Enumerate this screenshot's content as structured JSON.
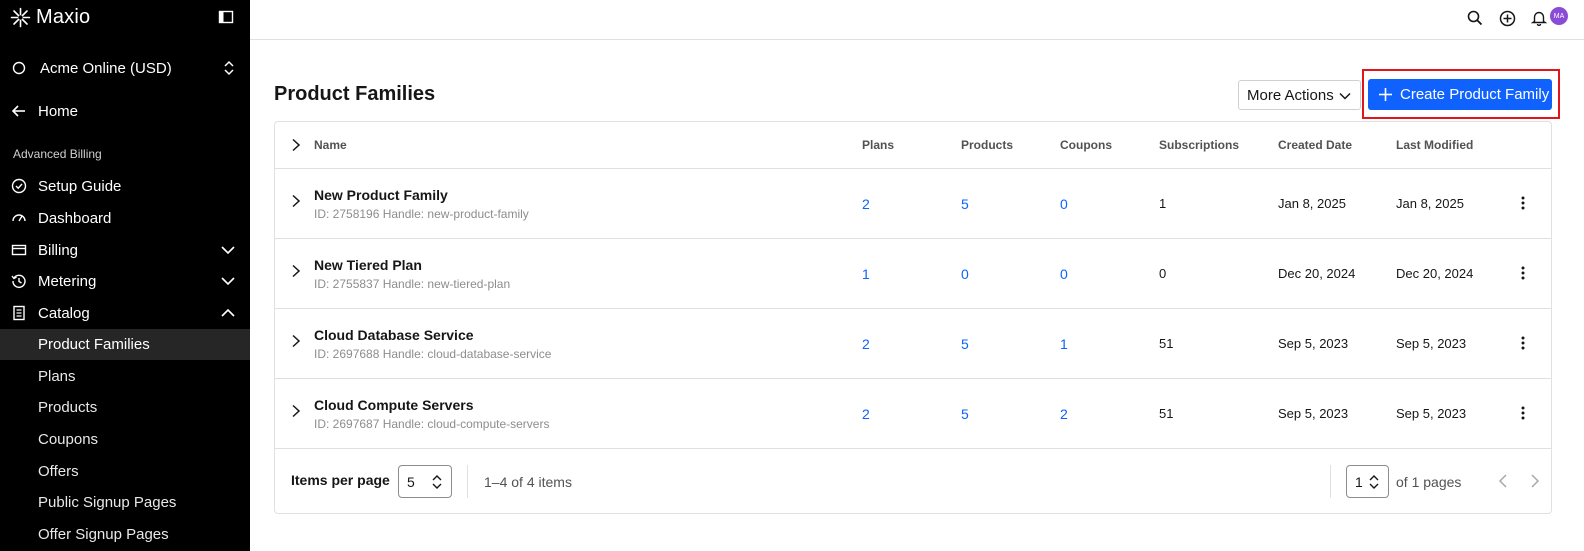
{
  "sidebar": {
    "logo": "Maxio",
    "account": "Acme Online (USD)",
    "home": "Home",
    "section": "Advanced Billing",
    "items": [
      {
        "label": "Setup Guide",
        "icon": "check-circle-icon"
      },
      {
        "label": "Dashboard",
        "icon": "gauge-icon"
      },
      {
        "label": "Billing",
        "icon": "card-icon"
      },
      {
        "label": "Metering",
        "icon": "history-icon"
      },
      {
        "label": "Catalog",
        "icon": "document-icon"
      }
    ],
    "catalog_items": [
      "Product Families",
      "Plans",
      "Products",
      "Coupons",
      "Offers",
      "Public Signup Pages",
      "Offer Signup Pages"
    ]
  },
  "topbar": {
    "avatar": "MA"
  },
  "page": {
    "title": "Product Families",
    "more_actions": "More Actions",
    "create": "Create Product Family"
  },
  "table": {
    "headers": [
      "Name",
      "Plans",
      "Products",
      "Coupons",
      "Subscriptions",
      "Created Date",
      "Last Modified"
    ],
    "rows": [
      {
        "name": "New Product Family",
        "meta": "ID: 2758196 Handle: new-product-family",
        "plans": "2",
        "products": "5",
        "coupons": "0",
        "subscriptions": "1",
        "created": "Jan 8, 2025",
        "modified": "Jan 8, 2025"
      },
      {
        "name": "New Tiered Plan",
        "meta": "ID: 2755837 Handle: new-tiered-plan",
        "plans": "1",
        "products": "0",
        "coupons": "0",
        "subscriptions": "0",
        "created": "Dec 20, 2024",
        "modified": "Dec 20, 2024"
      },
      {
        "name": "Cloud Database Service",
        "meta": "ID: 2697688 Handle: cloud-database-service",
        "plans": "2",
        "products": "5",
        "coupons": "1",
        "subscriptions": "51",
        "created": "Sep 5, 2023",
        "modified": "Sep 5, 2023"
      },
      {
        "name": "Cloud Compute Servers",
        "meta": "ID: 2697687 Handle: cloud-compute-servers",
        "plans": "2",
        "products": "5",
        "coupons": "2",
        "subscriptions": "51",
        "created": "Sep 5, 2023",
        "modified": "Sep 5, 2023"
      }
    ]
  },
  "pagination": {
    "items_per_page_label": "Items per page",
    "items_per_page": "5",
    "range": "1–4 of 4 items",
    "page": "1",
    "of_pages": "of 1 pages"
  },
  "colors": {
    "accent": "#0f62fe",
    "highlight": "#e0161b",
    "sidebar": "#000000"
  }
}
